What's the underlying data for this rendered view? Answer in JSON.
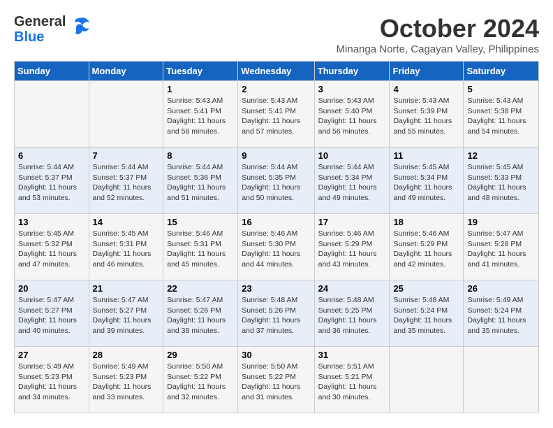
{
  "logo": {
    "general": "General",
    "blue": "Blue"
  },
  "title": "October 2024",
  "subtitle": "Minanga Norte, Cagayan Valley, Philippines",
  "weekdays": [
    "Sunday",
    "Monday",
    "Tuesday",
    "Wednesday",
    "Thursday",
    "Friday",
    "Saturday"
  ],
  "weeks": [
    [
      {
        "day": "",
        "sunrise": "",
        "sunset": "",
        "daylight": ""
      },
      {
        "day": "",
        "sunrise": "",
        "sunset": "",
        "daylight": ""
      },
      {
        "day": "1",
        "sunrise": "Sunrise: 5:43 AM",
        "sunset": "Sunset: 5:41 PM",
        "daylight": "Daylight: 11 hours and 58 minutes."
      },
      {
        "day": "2",
        "sunrise": "Sunrise: 5:43 AM",
        "sunset": "Sunset: 5:41 PM",
        "daylight": "Daylight: 11 hours and 57 minutes."
      },
      {
        "day": "3",
        "sunrise": "Sunrise: 5:43 AM",
        "sunset": "Sunset: 5:40 PM",
        "daylight": "Daylight: 11 hours and 56 minutes."
      },
      {
        "day": "4",
        "sunrise": "Sunrise: 5:43 AM",
        "sunset": "Sunset: 5:39 PM",
        "daylight": "Daylight: 11 hours and 55 minutes."
      },
      {
        "day": "5",
        "sunrise": "Sunrise: 5:43 AM",
        "sunset": "Sunset: 5:38 PM",
        "daylight": "Daylight: 11 hours and 54 minutes."
      }
    ],
    [
      {
        "day": "6",
        "sunrise": "Sunrise: 5:44 AM",
        "sunset": "Sunset: 5:37 PM",
        "daylight": "Daylight: 11 hours and 53 minutes."
      },
      {
        "day": "7",
        "sunrise": "Sunrise: 5:44 AM",
        "sunset": "Sunset: 5:37 PM",
        "daylight": "Daylight: 11 hours and 52 minutes."
      },
      {
        "day": "8",
        "sunrise": "Sunrise: 5:44 AM",
        "sunset": "Sunset: 5:36 PM",
        "daylight": "Daylight: 11 hours and 51 minutes."
      },
      {
        "day": "9",
        "sunrise": "Sunrise: 5:44 AM",
        "sunset": "Sunset: 5:35 PM",
        "daylight": "Daylight: 11 hours and 50 minutes."
      },
      {
        "day": "10",
        "sunrise": "Sunrise: 5:44 AM",
        "sunset": "Sunset: 5:34 PM",
        "daylight": "Daylight: 11 hours and 49 minutes."
      },
      {
        "day": "11",
        "sunrise": "Sunrise: 5:45 AM",
        "sunset": "Sunset: 5:34 PM",
        "daylight": "Daylight: 11 hours and 49 minutes."
      },
      {
        "day": "12",
        "sunrise": "Sunrise: 5:45 AM",
        "sunset": "Sunset: 5:33 PM",
        "daylight": "Daylight: 11 hours and 48 minutes."
      }
    ],
    [
      {
        "day": "13",
        "sunrise": "Sunrise: 5:45 AM",
        "sunset": "Sunset: 5:32 PM",
        "daylight": "Daylight: 11 hours and 47 minutes."
      },
      {
        "day": "14",
        "sunrise": "Sunrise: 5:45 AM",
        "sunset": "Sunset: 5:31 PM",
        "daylight": "Daylight: 11 hours and 46 minutes."
      },
      {
        "day": "15",
        "sunrise": "Sunrise: 5:46 AM",
        "sunset": "Sunset: 5:31 PM",
        "daylight": "Daylight: 11 hours and 45 minutes."
      },
      {
        "day": "16",
        "sunrise": "Sunrise: 5:46 AM",
        "sunset": "Sunset: 5:30 PM",
        "daylight": "Daylight: 11 hours and 44 minutes."
      },
      {
        "day": "17",
        "sunrise": "Sunrise: 5:46 AM",
        "sunset": "Sunset: 5:29 PM",
        "daylight": "Daylight: 11 hours and 43 minutes."
      },
      {
        "day": "18",
        "sunrise": "Sunrise: 5:46 AM",
        "sunset": "Sunset: 5:29 PM",
        "daylight": "Daylight: 11 hours and 42 minutes."
      },
      {
        "day": "19",
        "sunrise": "Sunrise: 5:47 AM",
        "sunset": "Sunset: 5:28 PM",
        "daylight": "Daylight: 11 hours and 41 minutes."
      }
    ],
    [
      {
        "day": "20",
        "sunrise": "Sunrise: 5:47 AM",
        "sunset": "Sunset: 5:27 PM",
        "daylight": "Daylight: 11 hours and 40 minutes."
      },
      {
        "day": "21",
        "sunrise": "Sunrise: 5:47 AM",
        "sunset": "Sunset: 5:27 PM",
        "daylight": "Daylight: 11 hours and 39 minutes."
      },
      {
        "day": "22",
        "sunrise": "Sunrise: 5:47 AM",
        "sunset": "Sunset: 5:26 PM",
        "daylight": "Daylight: 11 hours and 38 minutes."
      },
      {
        "day": "23",
        "sunrise": "Sunrise: 5:48 AM",
        "sunset": "Sunset: 5:26 PM",
        "daylight": "Daylight: 11 hours and 37 minutes."
      },
      {
        "day": "24",
        "sunrise": "Sunrise: 5:48 AM",
        "sunset": "Sunset: 5:25 PM",
        "daylight": "Daylight: 11 hours and 36 minutes."
      },
      {
        "day": "25",
        "sunrise": "Sunrise: 5:48 AM",
        "sunset": "Sunset: 5:24 PM",
        "daylight": "Daylight: 11 hours and 35 minutes."
      },
      {
        "day": "26",
        "sunrise": "Sunrise: 5:49 AM",
        "sunset": "Sunset: 5:24 PM",
        "daylight": "Daylight: 11 hours and 35 minutes."
      }
    ],
    [
      {
        "day": "27",
        "sunrise": "Sunrise: 5:49 AM",
        "sunset": "Sunset: 5:23 PM",
        "daylight": "Daylight: 11 hours and 34 minutes."
      },
      {
        "day": "28",
        "sunrise": "Sunrise: 5:49 AM",
        "sunset": "Sunset: 5:23 PM",
        "daylight": "Daylight: 11 hours and 33 minutes."
      },
      {
        "day": "29",
        "sunrise": "Sunrise: 5:50 AM",
        "sunset": "Sunset: 5:22 PM",
        "daylight": "Daylight: 11 hours and 32 minutes."
      },
      {
        "day": "30",
        "sunrise": "Sunrise: 5:50 AM",
        "sunset": "Sunset: 5:22 PM",
        "daylight": "Daylight: 11 hours and 31 minutes."
      },
      {
        "day": "31",
        "sunrise": "Sunrise: 5:51 AM",
        "sunset": "Sunset: 5:21 PM",
        "daylight": "Daylight: 11 hours and 30 minutes."
      },
      {
        "day": "",
        "sunrise": "",
        "sunset": "",
        "daylight": ""
      },
      {
        "day": "",
        "sunrise": "",
        "sunset": "",
        "daylight": ""
      }
    ]
  ]
}
